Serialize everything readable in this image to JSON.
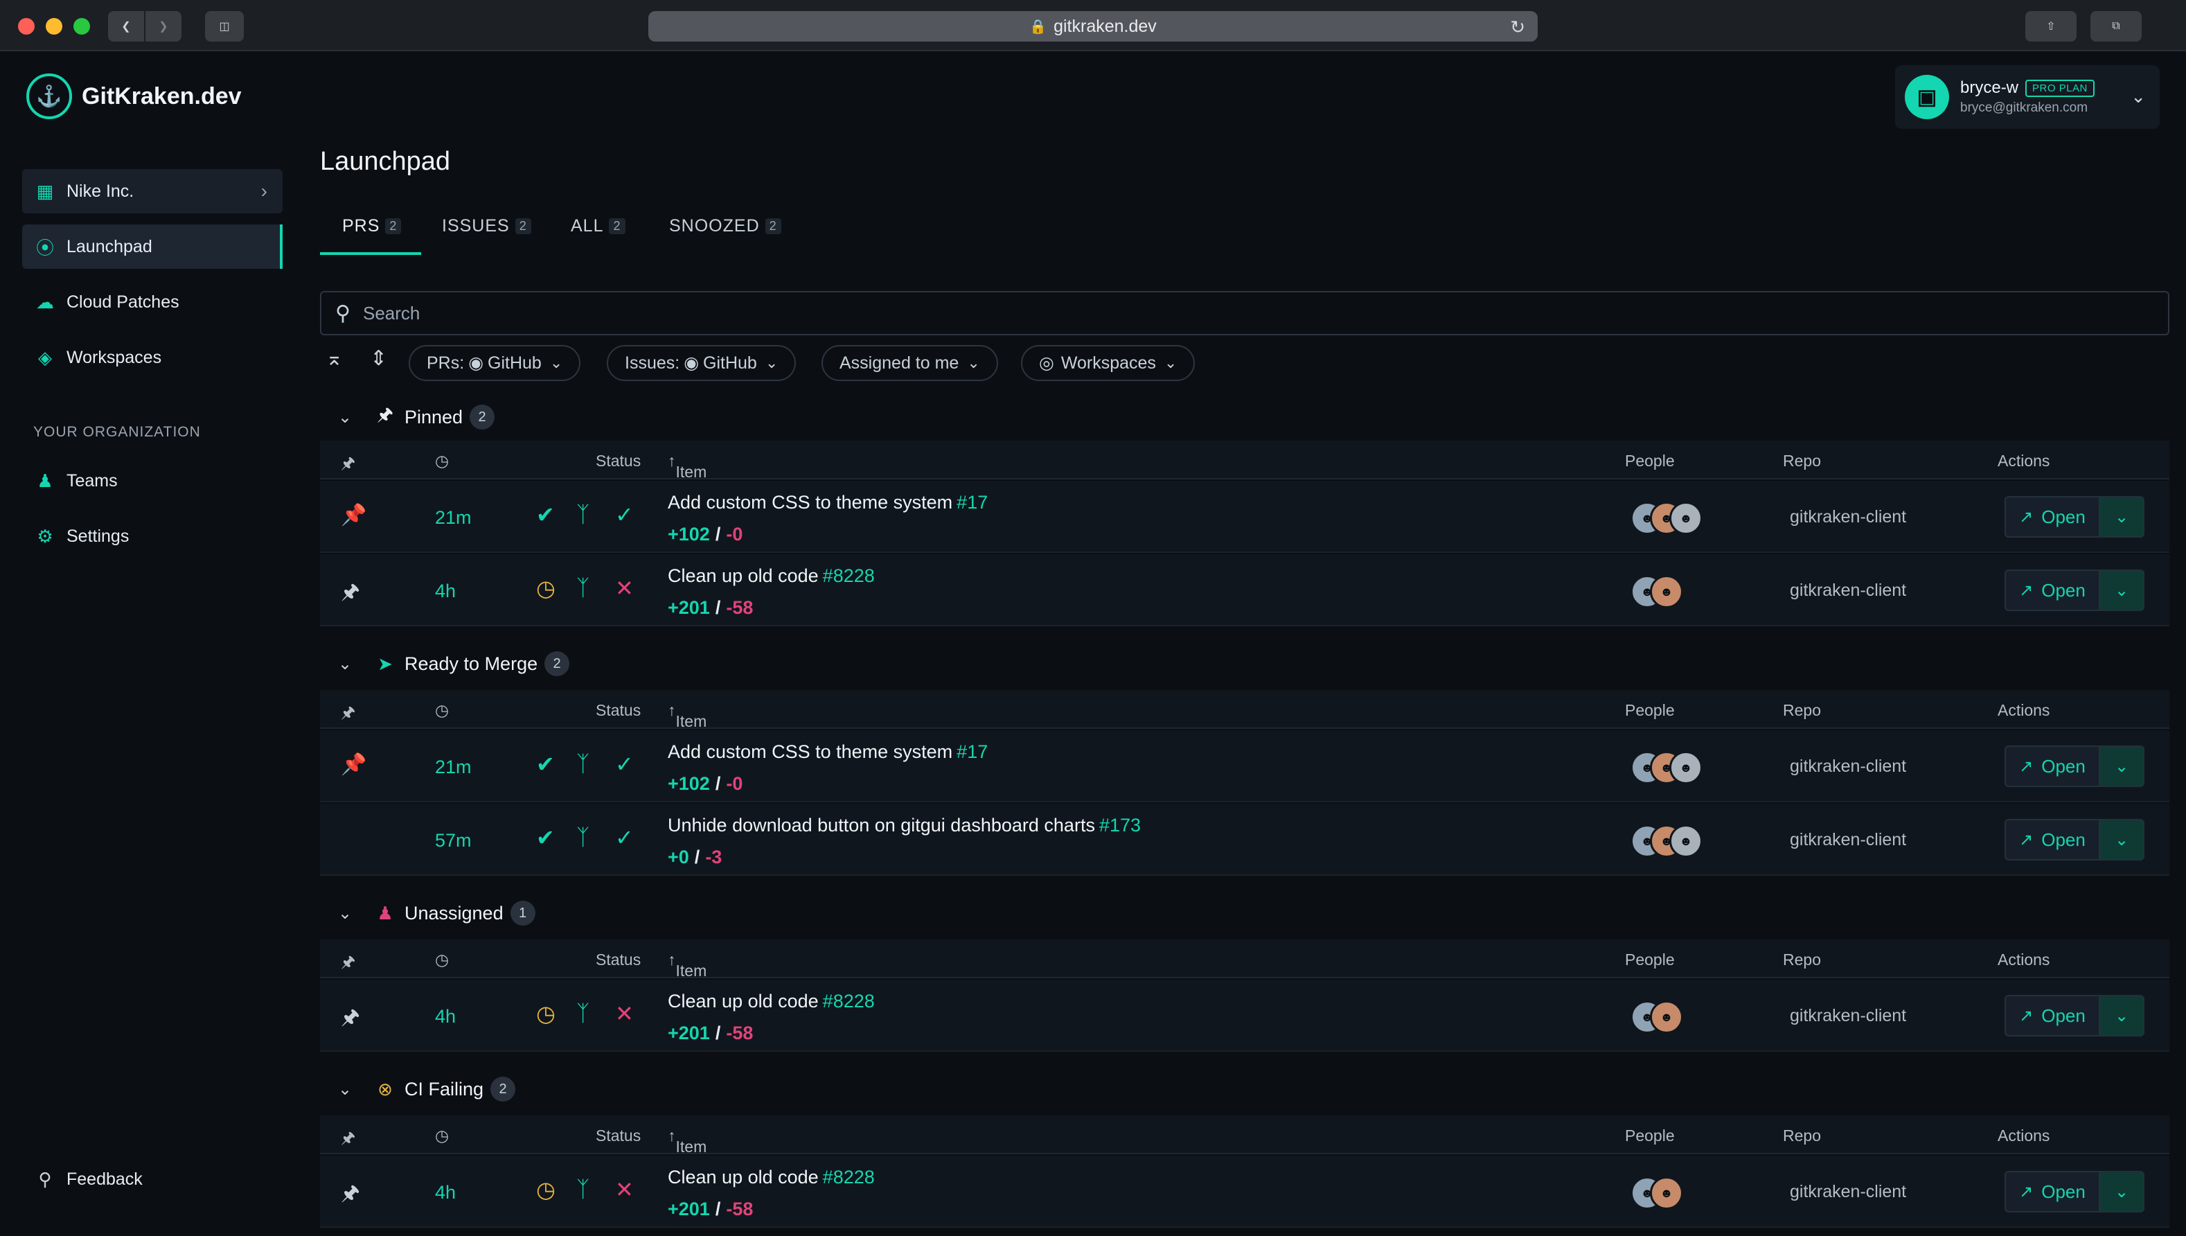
{
  "browser": {
    "url": "gitkraken.dev"
  },
  "app": {
    "name": "GitKraken.dev"
  },
  "sidebar": {
    "org_name": "Nike Inc.",
    "items": [
      {
        "label": "Launchpad",
        "icon": "compass-icon"
      },
      {
        "label": "Cloud Patches",
        "icon": "cloud-icon"
      },
      {
        "label": "Workspaces",
        "icon": "layers-icon"
      }
    ],
    "section_label": "YOUR ORGANIZATION",
    "org_items": [
      {
        "label": "Teams",
        "icon": "users-icon"
      },
      {
        "label": "Settings",
        "icon": "gear-icon"
      }
    ],
    "feedback": "Feedback"
  },
  "user": {
    "name": "bryce-w",
    "plan": "PRO PLAN",
    "email": "bryce@gitkraken.com"
  },
  "page": {
    "title": "Launchpad",
    "tabs": [
      {
        "label": "PRS",
        "count": "2"
      },
      {
        "label": "ISSUES",
        "count": "2"
      },
      {
        "label": "ALL",
        "count": "2"
      },
      {
        "label": "SNOOZED",
        "count": "2"
      }
    ],
    "search_placeholder": "Search",
    "filters": {
      "prs": "PRs:",
      "prs_provider": "GitHub",
      "issues": "Issues:",
      "issues_provider": "GitHub",
      "assigned": "Assigned to me",
      "workspaces": "Workspaces"
    },
    "columns": {
      "status": "Status",
      "item": "Item",
      "people": "People",
      "repo": "Repo",
      "actions": "Actions"
    },
    "open_label": "Open"
  },
  "groups": [
    {
      "name": "Pinned",
      "count": "2",
      "rows": [
        {
          "age": "21m",
          "title": "Add custom CSS to theme system",
          "num": "#17",
          "add": "+102",
          "del": "-0",
          "repo": "gitkraken-client"
        },
        {
          "age": "4h",
          "title": "Clean up old code",
          "num": "#8228",
          "add": "+201",
          "del": "-58",
          "repo": "gitkraken-client"
        }
      ]
    },
    {
      "name": "Ready to Merge",
      "count": "2",
      "rows": [
        {
          "age": "21m",
          "title": "Add custom CSS to theme system",
          "num": "#17",
          "add": "+102",
          "del": "-0",
          "repo": "gitkraken-client"
        },
        {
          "age": "57m",
          "title": "Unhide download button on gitgui dashboard charts",
          "num": "#173",
          "add": "+0",
          "del": "-3",
          "repo": "gitkraken-client"
        }
      ]
    },
    {
      "name": "Unassigned",
      "count": "1",
      "rows": [
        {
          "age": "4h",
          "title": "Clean up old code",
          "num": "#8228",
          "add": "+201",
          "del": "-58",
          "repo": "gitkraken-client"
        }
      ]
    },
    {
      "name": "CI Failing",
      "count": "2",
      "rows": [
        {
          "age": "4h",
          "title": "Clean up old code",
          "num": "#8228",
          "add": "+201",
          "del": "-58",
          "repo": "gitkraken-client"
        }
      ]
    }
  ],
  "colors": {
    "accent": "#14d6b0",
    "warning": "#e7b33c",
    "danger": "#e0437a",
    "background": "#0b0f14"
  }
}
